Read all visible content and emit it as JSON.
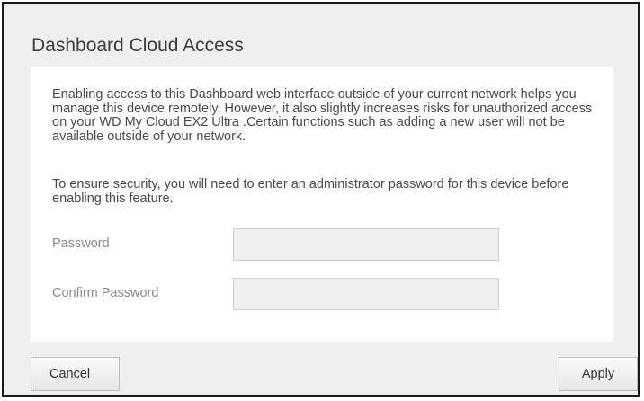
{
  "dialog": {
    "title": "Dashboard Cloud Access",
    "description": "Enabling access to this Dashboard web interface outside of your current network helps you manage this device remotely. However, it also slightly increases risks for unauthorized access on your WD My Cloud EX2 Ultra .Certain functions such as adding a new user will not be available outside of your network.",
    "security_note": "To ensure security, you will need to enter an administrator password for this device before enabling this feature.",
    "password_label": "Password",
    "password_value": "",
    "confirm_password_label": "Confirm Password",
    "confirm_password_value": "",
    "cancel_label": "Cancel",
    "apply_label": "Apply"
  }
}
